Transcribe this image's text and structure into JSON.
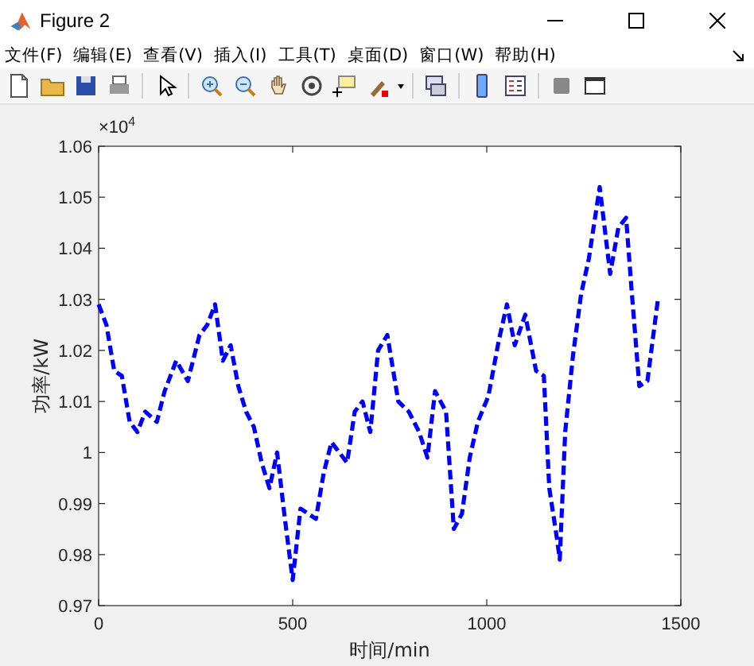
{
  "window": {
    "title": "Figure 2"
  },
  "menu": [
    {
      "label": "文件(F)"
    },
    {
      "label": "编辑(E)"
    },
    {
      "label": "查看(V)"
    },
    {
      "label": "插入(I)"
    },
    {
      "label": "工具(T)"
    },
    {
      "label": "桌面(D)"
    },
    {
      "label": "窗口(W)"
    },
    {
      "label": "帮助(H)"
    }
  ],
  "figure": {
    "exponent_label": "×10$^{4}$",
    "chart_data": {
      "type": "line",
      "xlabel": "时间/min",
      "ylabel": "功率/kW",
      "xlim": [
        0,
        1500
      ],
      "ylim": [
        0.97,
        1.06
      ],
      "xticks": [
        0,
        500,
        1000,
        1500
      ],
      "yticks": [
        0.97,
        0.98,
        0.99,
        {
          "value": 1,
          "label": "1"
        },
        1.01,
        1.02,
        1.03,
        1.04,
        1.05,
        1.06
      ],
      "x": [
        0,
        20,
        40,
        60,
        80,
        100,
        120,
        150,
        170,
        200,
        230,
        260,
        280,
        300,
        320,
        340,
        360,
        380,
        400,
        420,
        440,
        460,
        480,
        500,
        520,
        540,
        560,
        580,
        600,
        620,
        640,
        660,
        680,
        700,
        720,
        744,
        772,
        799,
        826,
        847,
        867,
        895,
        915,
        936,
        956,
        977,
        1004,
        1031,
        1052,
        1072,
        1099,
        1127,
        1147,
        1161,
        1181,
        1188,
        1202,
        1222,
        1243,
        1263,
        1291,
        1318,
        1339,
        1359,
        1373,
        1393,
        1414,
        1441
      ],
      "series": [
        {
          "color": "#0000ff",
          "line_style": "dashed",
          "values": [
            1.029,
            1.025,
            1.016,
            1.015,
            1.006,
            1.004,
            1.008,
            1.006,
            1.012,
            1.018,
            1.014,
            1.023,
            1.025,
            1.029,
            1.018,
            1.021,
            1.013,
            1.008,
            1.005,
            0.998,
            0.993,
            1.0,
            0.987,
            0.975,
            0.989,
            0.988,
            0.987,
            0.996,
            1.002,
            1.0,
            0.998,
            1.008,
            1.01,
            1.004,
            1.02,
            1.023,
            1.01,
            1.008,
            1.004,
            0.999,
            1.012,
            1.008,
            0.985,
            0.988,
            0.999,
            1.006,
            1.011,
            1.022,
            1.029,
            1.021,
            1.027,
            1.016,
            1.015,
            0.993,
            0.983,
            0.979,
            1.004,
            1.019,
            1.031,
            1.038,
            1.052,
            1.035,
            1.044,
            1.046,
            1.032,
            1.013,
            1.014,
            1.03
          ]
        }
      ]
    }
  }
}
